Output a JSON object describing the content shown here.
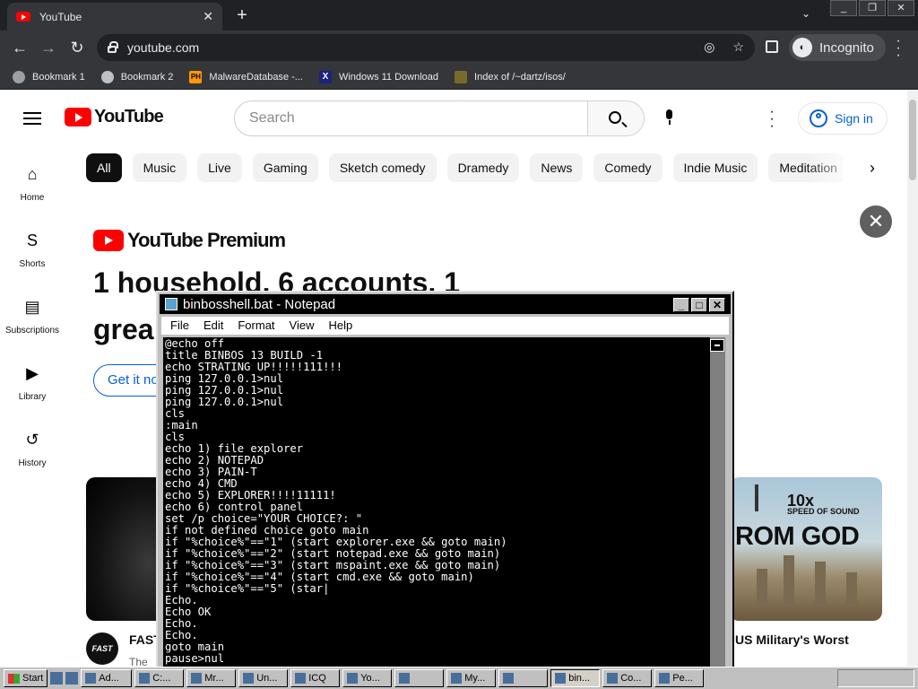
{
  "browser": {
    "tab_title": "YouTube",
    "tab_close": "✕",
    "new_tab": "+",
    "tab_search": "⌄",
    "window_buttons": [
      "_",
      "❐",
      "✕"
    ],
    "nav": {
      "back": "←",
      "forward": "→",
      "reload": "↻"
    },
    "url": "youtube.com",
    "profile_label": "Incognito",
    "bookmarks": [
      {
        "label": "Bookmark 1",
        "icon": "generic-site-icon"
      },
      {
        "label": "Bookmark 2",
        "icon": "globe-icon"
      },
      {
        "label": "MalwareDatabase -...",
        "icon": "ph-icon"
      },
      {
        "label": "Windows 11 Download",
        "icon": "x-icon"
      },
      {
        "label": "Index of /~dartz/isos/",
        "icon": "index-icon"
      }
    ],
    "ph_glyph": "PH",
    "x_glyph": "X"
  },
  "youtube": {
    "logo_text": "YouTube",
    "search_placeholder": "Search",
    "sign_in": "Sign in",
    "guide": [
      {
        "label": "Home",
        "glyph": "⌂"
      },
      {
        "label": "Shorts",
        "glyph": "S"
      },
      {
        "label": "Subscriptions",
        "glyph": "▤"
      },
      {
        "label": "Library",
        "glyph": "▶"
      },
      {
        "label": "History",
        "glyph": "↺"
      }
    ],
    "chips": [
      "All",
      "Music",
      "Live",
      "Gaming",
      "Sketch comedy",
      "Dramedy",
      "News",
      "Comedy",
      "Indie Music",
      "Meditation"
    ],
    "chip_next": "›",
    "banner_close": "✕",
    "premium_logo_text": "YouTube Premium",
    "premium_heading_1": "1 household, 6 accounts, 1",
    "premium_heading_2": "grea",
    "premium_cta": "Get it no",
    "video_left": {
      "avatar_text": "FAST",
      "title": "FAST",
      "subtitle": "The"
    },
    "video_right": {
      "speed": "10x",
      "speed_sub": "SPEED OF SOUND",
      "headline": "ROM GOD",
      "title": "US Military's Worst"
    }
  },
  "notepad": {
    "title": "binbosshell.bat - Notepad",
    "buttons": [
      "_",
      "□",
      "✕"
    ],
    "menu": [
      "File",
      "Edit",
      "Format",
      "View",
      "Help"
    ],
    "content": "@echo off\ntitle BINBOS 13 BUILD -1\necho STRATING UP!!!!!111!!!\nping 127.0.0.1>nul\nping 127.0.0.1>nul\nping 127.0.0.1>nul\ncls\n:main\ncls\necho 1) file explorer\necho 2) NOTEPAD\necho 3) PAIN-T\necho 4) CMD\necho 5) EXPLORER!!!!11111!\necho 6) control panel\nset /p choice=\"YOUR CHOICE?: \"\nif not defined choice goto main\nif \"%choice%\"==\"1\" (start explorer.exe && goto main)\nif \"%choice%\"==\"2\" (start notepad.exe && goto main)\nif \"%choice%\"==\"3\" (start mspaint.exe && goto main)\nif \"%choice%\"==\"4\" (start cmd.exe && goto main)\nif \"%choice%\"==\"5\" (star|\nEcho.\nEcho OK\nEcho.\nEcho.\ngoto main\npause>nul"
  },
  "taskbar": {
    "start": "Start",
    "tasks": [
      "Ad...",
      "C:...",
      "Mr...",
      "Un...",
      "ICQ",
      "Yo...",
      "",
      "My...",
      "",
      "bin...",
      "Co...",
      "Pe..."
    ]
  }
}
